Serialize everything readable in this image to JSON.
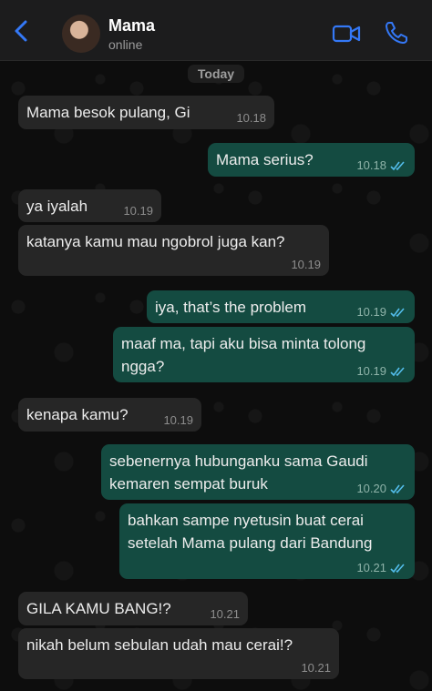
{
  "header": {
    "contact_name": "Mama",
    "status": "online"
  },
  "chat": {
    "date_label": "Today",
    "messages": [
      {
        "dir": "in",
        "text": "Mama besok pulang, Gi",
        "time": "10.18"
      },
      {
        "dir": "out",
        "text": "Mama serius?",
        "time": "10.18"
      },
      {
        "dir": "in",
        "text": "ya iyalah",
        "time": "10.19"
      },
      {
        "dir": "in",
        "text": "katanya kamu mau ngobrol juga kan?",
        "time": "10.19"
      },
      {
        "dir": "out",
        "text": "iya, that’s the problem",
        "time": "10.19"
      },
      {
        "dir": "out",
        "text": "maaf ma, tapi aku bisa minta tolong ngga?",
        "time": "10.19"
      },
      {
        "dir": "in",
        "text": "kenapa kamu?",
        "time": "10.19"
      },
      {
        "dir": "out",
        "text": "sebenernya hubunganku sama Gaudi kemaren sempat buruk",
        "time": "10.20"
      },
      {
        "dir": "out",
        "text": "bahkan sampe nyetusin buat cerai setelah Mama pulang dari Bandung",
        "time": "10.21"
      },
      {
        "dir": "in",
        "text": "GILA KAMU BANG!?",
        "time": "10.21"
      },
      {
        "dir": "in",
        "text": "nikah belum sebulan udah mau cerai!?",
        "time": "10.21"
      }
    ]
  },
  "icons": {
    "back": "chevron-left-icon",
    "video": "video-camera-icon",
    "call": "phone-icon",
    "read_receipt": "double-check-icon"
  },
  "colors": {
    "accent": "#3478f6",
    "incoming_bubble": "#262626",
    "outgoing_bubble": "#144b41",
    "read_ticks": "#53bdeb"
  }
}
